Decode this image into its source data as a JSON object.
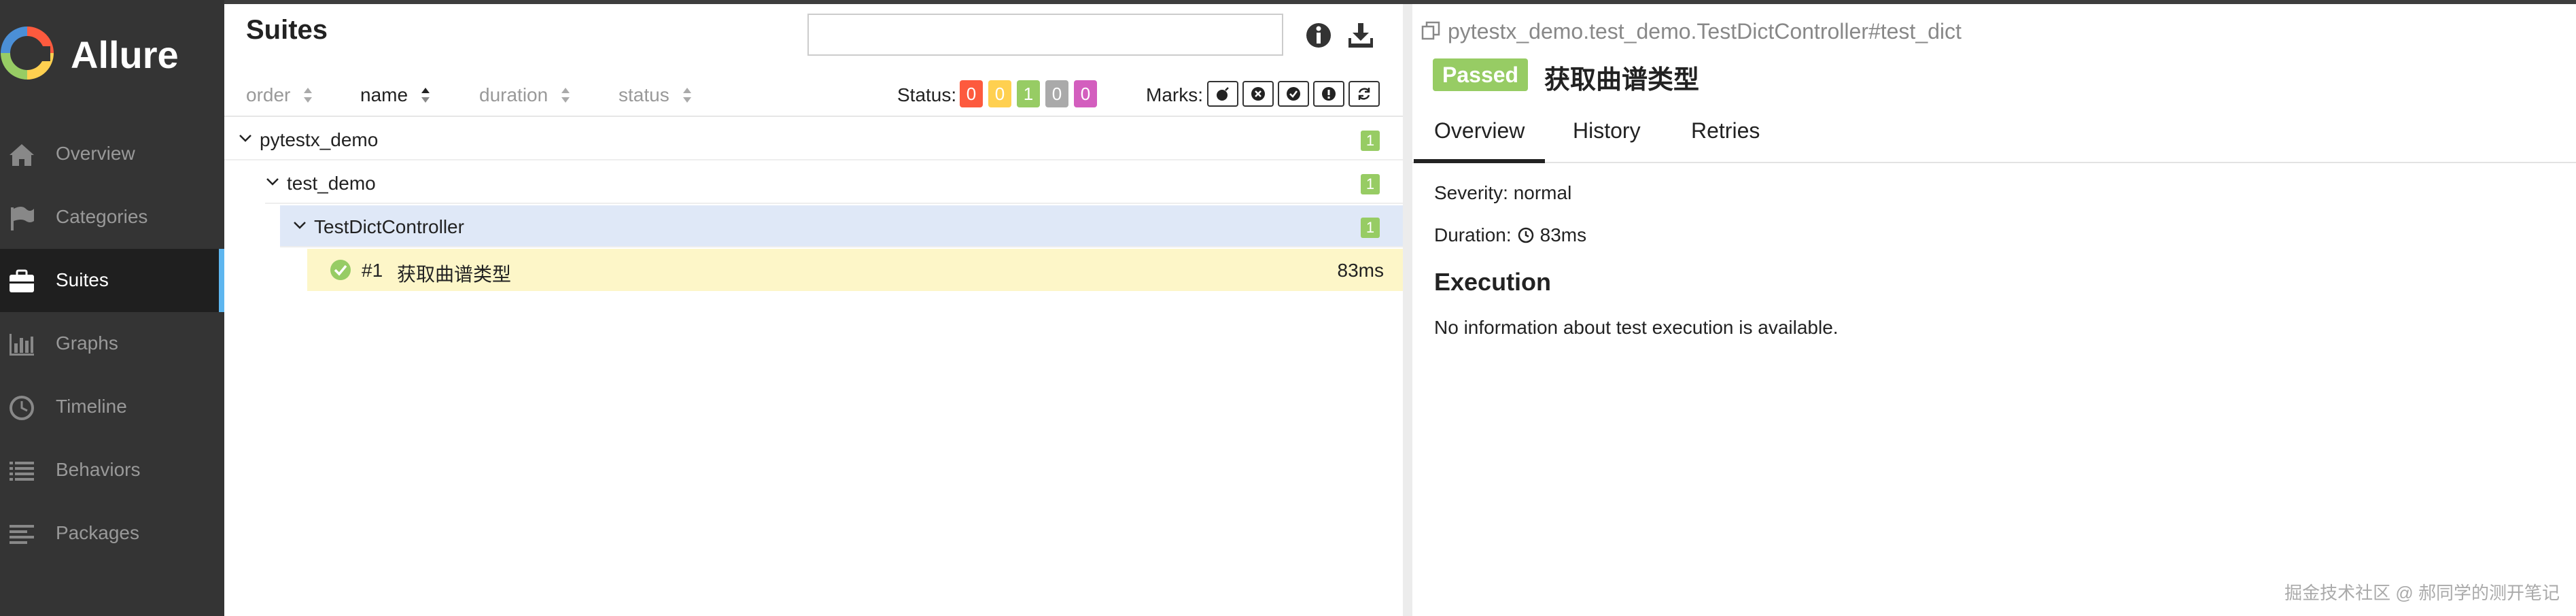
{
  "sidebar": {
    "brand": "Allure",
    "items": [
      {
        "label": "Overview",
        "icon": "home-icon"
      },
      {
        "label": "Categories",
        "icon": "flag-icon"
      },
      {
        "label": "Suites",
        "icon": "briefcase-icon",
        "active": true
      },
      {
        "label": "Graphs",
        "icon": "bar-chart-icon"
      },
      {
        "label": "Timeline",
        "icon": "clock-icon"
      },
      {
        "label": "Behaviors",
        "icon": "list-icon"
      },
      {
        "label": "Packages",
        "icon": "align-left-icon"
      }
    ]
  },
  "suites": {
    "title": "Suites",
    "search": {
      "value": "",
      "placeholder": ""
    },
    "sort": {
      "order": "order",
      "name": "name",
      "duration": "duration",
      "status": "status"
    },
    "status_label": "Status:",
    "status_counts": [
      {
        "value": "0",
        "color": "#fd5a3e"
      },
      {
        "value": "0",
        "color": "#ffd050"
      },
      {
        "value": "1",
        "color": "#97cc64"
      },
      {
        "value": "0",
        "color": "#aaaaaa"
      },
      {
        "value": "0",
        "color": "#d35ebe"
      }
    ],
    "marks_label": "Marks:",
    "tree": {
      "suite": {
        "label": "pytestx_demo",
        "count": "1"
      },
      "module": {
        "label": "test_demo",
        "count": "1"
      },
      "class": {
        "label": "TestDictController",
        "count": "1"
      },
      "test": {
        "num": "#1",
        "name": "获取曲谱类型",
        "duration": "83ms"
      }
    }
  },
  "details": {
    "path": "pytestx_demo.test_demo.TestDictController#test_dict",
    "status": "Passed",
    "title": "获取曲谱类型",
    "tabs": [
      "Overview",
      "History",
      "Retries"
    ],
    "severity": "Severity: normal",
    "duration_label": "Duration:",
    "duration_value": "83ms",
    "execution_title": "Execution",
    "execution_text": "No information about test execution is available."
  },
  "watermark": "掘金技术社区 @ 郝同学的测开笔记",
  "colors": {
    "passed": "#97cc64",
    "sidebar": "#343434",
    "selected_row": "#dfe8f7",
    "leaf_row": "#fdf6c8",
    "accent": "#5eb6ef"
  }
}
